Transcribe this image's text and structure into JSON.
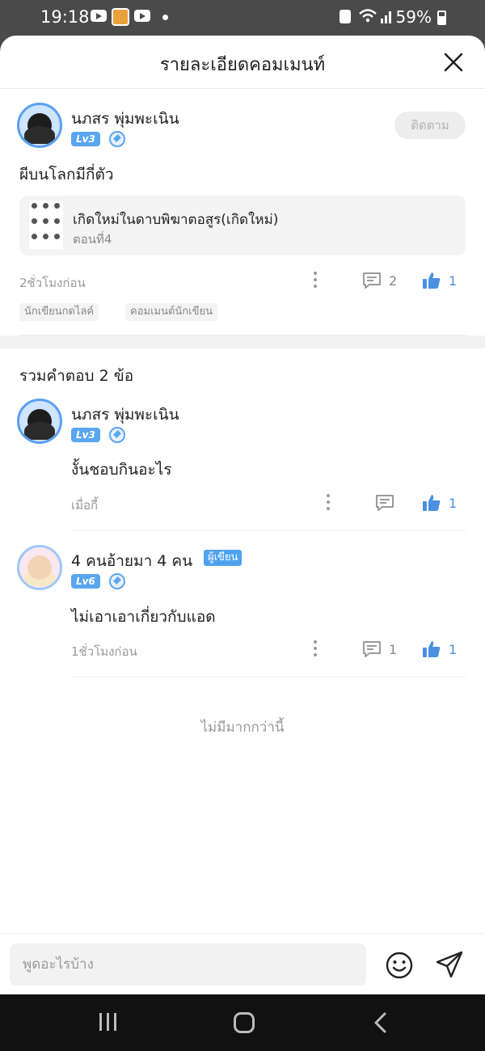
{
  "status_bar": {
    "time": "19:18",
    "battery": "59%"
  },
  "header": {
    "title": "รายละเอียดคอมเมนท์"
  },
  "main_comment": {
    "username": "นภสร พุ่มพะเนิน",
    "level": "Lv3",
    "follow_label": "ติดตาม",
    "text": "ผีบนโลกมีกี่ตัว",
    "novel": {
      "title": "เกิดใหม่ในดาบพิฆาตอสูร(เกิดใหม่)",
      "episode": "ตอนที่4"
    },
    "time": "2ชั่วโมงก่อน",
    "reply_count": "2",
    "like_count": "1",
    "tags": [
      "นักเขียนกดไลค์",
      "คอมเมนต์นักเขียน"
    ]
  },
  "replies_section": {
    "title": "รวมคำตอบ 2 ข้อ"
  },
  "replies": [
    {
      "username": "นภสร พุ่มพะเนิน",
      "level": "Lv3",
      "text": "งั้นชอบกินอะไร",
      "time": "เมื่อกี้",
      "like_count": "1"
    },
    {
      "username": "4 คนอ้ายมา 4 คน",
      "writer_tag": "ผู้เขียน",
      "level": "Lv6",
      "text": "ไม่เอาเอาเกี่ยวกับแอด",
      "time": "1ชั่วโมงก่อน",
      "reply_count": "1",
      "like_count": "1"
    }
  ],
  "no_more": "ไม่มีมากกว่านี้",
  "input": {
    "placeholder": "พูดอะไรบ้าง"
  },
  "colors": {
    "accent": "#4a90e2",
    "level_badge": "#5aa6f0",
    "muted": "#9a9a9a"
  }
}
